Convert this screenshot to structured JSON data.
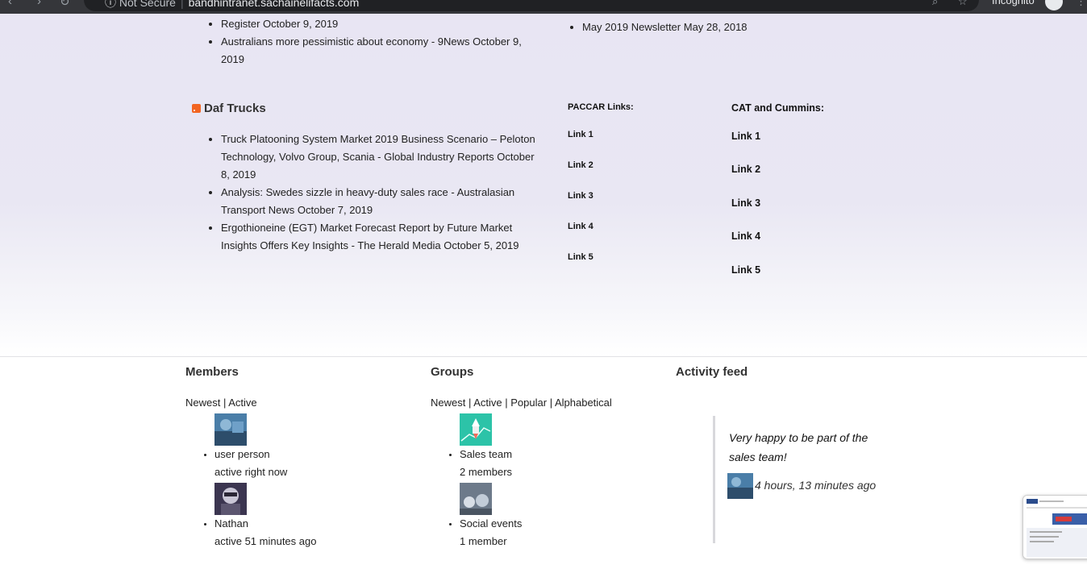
{
  "browser": {
    "security_label": "Not Secure",
    "url": "bandhintranet.sachainelifacts.com",
    "mode_label": "Incognito"
  },
  "previous_feed": {
    "items": [
      {
        "title": "Register",
        "date": "October 9, 2019"
      },
      {
        "title": "Australians more pessimistic about economy - 9News",
        "date": "October 9, 2019"
      }
    ]
  },
  "newsletter": {
    "items": [
      {
        "title": "May 2019 Newsletter",
        "date": "May 28, 2018"
      }
    ]
  },
  "daf": {
    "title": "Daf Trucks",
    "items": [
      {
        "title": "Truck Platooning System Market 2019 Business Scenario – Peloton Technology, Volvo Group, Scania - Global Industry Reports",
        "date": "October 8, 2019"
      },
      {
        "title": "Analysis: Swedes sizzle in heavy-duty sales race - Australasian Transport News",
        "date": "October 7, 2019"
      },
      {
        "title": "Ergothioneine (EGT) Market Forecast Report by Future Market Insights Offers Key Insights - The Herald Media",
        "date": "October 5, 2019"
      }
    ]
  },
  "paccar": {
    "heading": "PACCAR Links:",
    "links": [
      "Link 1",
      "Link 2",
      "Link 3",
      "Link 4",
      "Link 5"
    ]
  },
  "cat": {
    "heading": "CAT and Cummins:",
    "links": [
      "Link 1",
      "Link 2",
      "Link 3",
      "Link 4",
      "Link 5"
    ]
  },
  "members": {
    "title": "Members",
    "filters": [
      "Newest",
      "Active"
    ],
    "items": [
      {
        "name": "user person",
        "status": "active right now"
      },
      {
        "name": "Nathan",
        "status": "active 51 minutes ago"
      }
    ]
  },
  "groups": {
    "title": "Groups",
    "filters": [
      "Newest",
      "Active",
      "Popular",
      "Alphabetical"
    ],
    "items": [
      {
        "name": "Sales team",
        "count": "2 members"
      },
      {
        "name": "Social events",
        "count": "1 member"
      }
    ]
  },
  "activity": {
    "title": "Activity feed",
    "quote": "Very happy to be part of the sales team!",
    "time": "4 hours, 13 minutes ago"
  }
}
